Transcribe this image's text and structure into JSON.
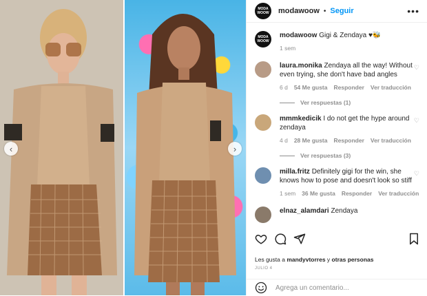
{
  "post": {
    "username": "modawoow",
    "avatar_text": "MODA WOOW",
    "follow_label": "Seguir",
    "more_label": "•••",
    "caption": "Gigi & Zendaya ♥🐝",
    "caption_time": "1 sem"
  },
  "comments": [
    {
      "user": "laura.monika",
      "text": "Zendaya all the way! Without even trying, she don't have bad angles",
      "time": "6 d",
      "likes": "54 Me gusta",
      "reply": "Responder",
      "translate": "Ver traducción",
      "replies_label": "Ver respuestas (1)",
      "avatar_color": "#b89b86"
    },
    {
      "user": "mmmkedicik",
      "text": "I do not get the hype around zendaya",
      "time": "4 d",
      "likes": "28 Me gusta",
      "reply": "Responder",
      "translate": "Ver traducción",
      "replies_label": "Ver respuestas (3)",
      "avatar_color": "#c9a77a"
    },
    {
      "user": "milla.fritz",
      "text": "Definitely gigi for the win, she knows how to pose and doesn't look so stiff",
      "time": "1 sem",
      "likes": "36 Me gusta",
      "reply": "Responder",
      "translate": "Ver traducción",
      "replies_label": "",
      "avatar_color": "#6f8fb0"
    },
    {
      "user": "elnaz_alamdari",
      "text": "Zendaya",
      "avatar_color": "#8a7a6a"
    }
  ],
  "likes_text_prefix": "Les gusta a",
  "likes_user": "mandyvtorres",
  "likes_suffix_connector": "y",
  "likes_others": "otras personas",
  "date": "JULIO 4",
  "comment_placeholder": "Agrega un comentario...",
  "colors": {
    "accent": "#0095f6",
    "muted": "#8e8e8e"
  }
}
